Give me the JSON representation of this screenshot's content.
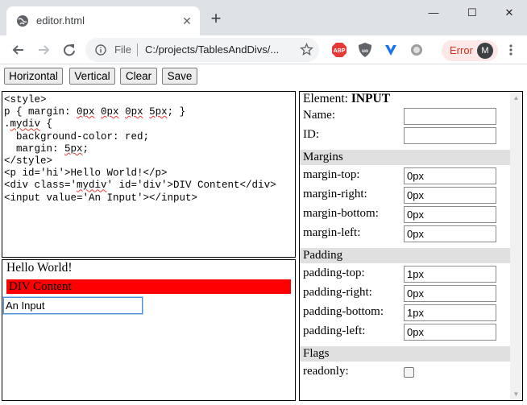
{
  "browser": {
    "tab_title": "editor.html",
    "tab_close": "✕",
    "new_tab": "+",
    "window_controls": {
      "minimize": "—",
      "maximize": "☐",
      "close": "✕"
    },
    "url_scheme": "File",
    "url": "C:/projects/TablesAndDivs/...",
    "error_label": "Error",
    "avatar_initial": "M",
    "extensions": [
      "abp-icon",
      "ublock-icon",
      "vpn-icon",
      "circle-extension-icon"
    ]
  },
  "toolbar": {
    "horizontal": "Horizontal",
    "vertical": "Vertical",
    "clear": "Clear",
    "save": "Save"
  },
  "code": {
    "lines": [
      "<style>",
      "p { margin: 0px 0px 0px 5px; }",
      ".mydiv {",
      "  background-color: red;",
      "  margin: 5px;",
      "</style>",
      "<p id='hi'>Hello World!</p>",
      "<div class='mydiv' id='div'>DIV Content</div>",
      "<input value='An Input'></input>"
    ]
  },
  "preview": {
    "paragraph": "Hello World!",
    "div_text": "DIV Content",
    "input_value": "An Input",
    "div_color": "#ff0000"
  },
  "properties": {
    "element_label": "Element:",
    "element_name": "INPUT",
    "name_label": "Name:",
    "name_value": "",
    "id_label": "ID:",
    "id_value": "",
    "margins_header": "Margins",
    "margin_top_label": "margin-top:",
    "margin_top": "0px",
    "margin_right_label": "margin-right:",
    "margin_right": "0px",
    "margin_bottom_label": "margin-bottom:",
    "margin_bottom": "0px",
    "margin_left_label": "margin-left:",
    "margin_left": "0px",
    "padding_header": "Padding",
    "padding_top_label": "padding-top:",
    "padding_top": "1px",
    "padding_right_label": "padding-right:",
    "padding_right": "0px",
    "padding_bottom_label": "padding-bottom:",
    "padding_bottom": "1px",
    "padding_left_label": "padding-left:",
    "padding_left": "0px",
    "flags_header": "Flags",
    "readonly_label": "readonly:",
    "readonly": false
  }
}
